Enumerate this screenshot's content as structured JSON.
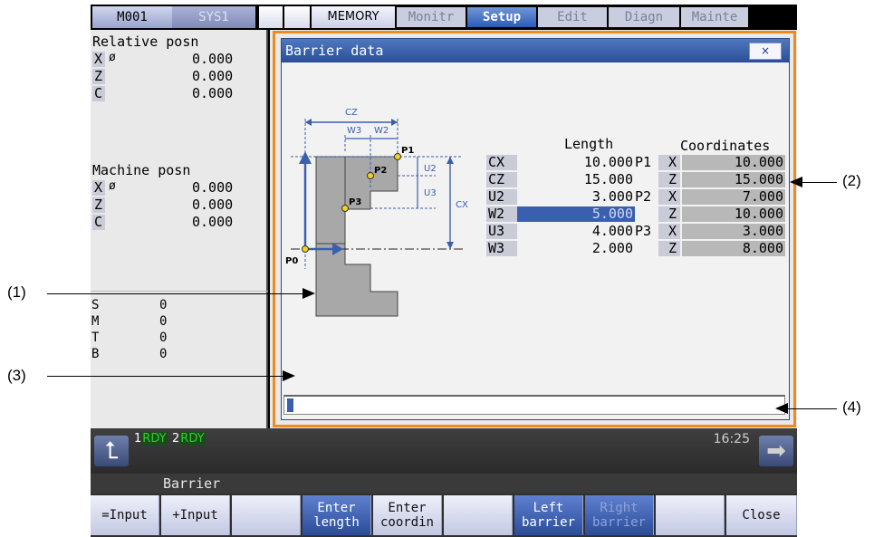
{
  "tabs": {
    "m001": "M001",
    "sys1": "SYS1",
    "memory": "MEMORY",
    "modes": [
      "Monitr",
      "Setup",
      "Edit",
      "Diagn",
      "Mainte"
    ]
  },
  "left_panel": {
    "relative_title": "Relative posn",
    "relative": [
      {
        "axis": "X",
        "mark": "ø",
        "value": "0.000"
      },
      {
        "axis": "Z",
        "mark": "",
        "value": "0.000"
      },
      {
        "axis": "C",
        "mark": "",
        "value": "0.000"
      }
    ],
    "machine_title": "Machine posn",
    "machine": [
      {
        "axis": "X",
        "mark": "ø",
        "value": "0.000"
      },
      {
        "axis": "Z",
        "mark": "",
        "value": "0.000"
      },
      {
        "axis": "C",
        "mark": "",
        "value": "0.000"
      }
    ],
    "smtb": [
      {
        "label": "S",
        "value": "0"
      },
      {
        "label": "M",
        "value": "0"
      },
      {
        "label": "T",
        "value": "0"
      },
      {
        "label": "B",
        "value": "0"
      }
    ]
  },
  "dialog": {
    "title": "Barrier data",
    "close": "×",
    "header_length": "Length",
    "header_coordinates": "Coordinates",
    "rows": [
      {
        "label": "CX",
        "length": "10.000",
        "point": "P1",
        "axis": "X",
        "coord": "10.000"
      },
      {
        "label": "CZ",
        "length": "15.000",
        "point": "",
        "axis": "Z",
        "coord": "15.000"
      },
      {
        "label": "U2",
        "length": "3.000",
        "point": "P2",
        "axis": "X",
        "coord": "7.000"
      },
      {
        "label": "W2",
        "length": "5.000",
        "point": "",
        "axis": "Z",
        "coord": "10.000"
      },
      {
        "label": "U3",
        "length": "4.000",
        "point": "P3",
        "axis": "X",
        "coord": "3.000"
      },
      {
        "label": "W3",
        "length": "2.000",
        "point": "",
        "axis": "Z",
        "coord": "8.000"
      }
    ],
    "diagram": {
      "cz": "CZ",
      "w3": "W3",
      "w2": "W2",
      "u2": "U2",
      "u3": "U3",
      "cx": "CX",
      "p0": "P0",
      "p1": "P1",
      "p2": "P2",
      "p3": "P3"
    }
  },
  "status": {
    "rdy1_num": "1",
    "rdy1": "RDY",
    "rdy2_num": "2",
    "rdy2": "RDY",
    "time": "16:25",
    "menu_title": "Barrier"
  },
  "softkeys": [
    {
      "line1": "=Input",
      "line2": ""
    },
    {
      "line1": "+Input",
      "line2": ""
    },
    {
      "line1": "",
      "line2": ""
    },
    {
      "line1": "Enter",
      "line2": "length"
    },
    {
      "line1": "Enter",
      "line2": "coordin"
    },
    {
      "line1": "",
      "line2": ""
    },
    {
      "line1": "Left",
      "line2": "barrier"
    },
    {
      "line1": "Right",
      "line2": "barrier"
    },
    {
      "line1": "",
      "line2": ""
    },
    {
      "line1": "Close",
      "line2": ""
    }
  ],
  "callouts": {
    "c1": "(1)",
    "c2": "(2)",
    "c3": "(3)",
    "c4": "(4)"
  },
  "colors": {
    "accent_orange": "#ef8a1e",
    "title_blue": "#2a4e97",
    "selection": "#3a5fae"
  }
}
